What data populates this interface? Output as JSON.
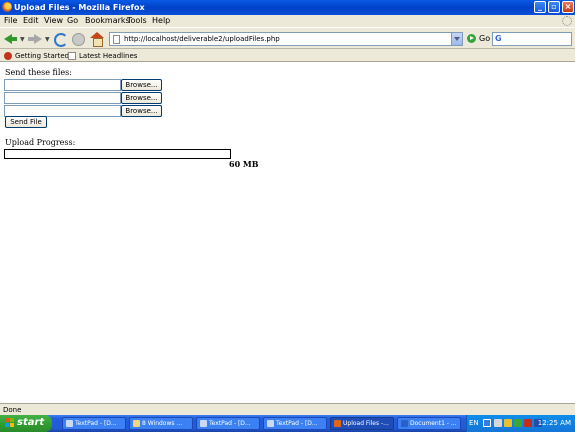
{
  "window": {
    "title": "Upload Files - Mozilla Firefox"
  },
  "menu": [
    "File",
    "Edit",
    "View",
    "Go",
    "Bookmarks",
    "Tools",
    "Help"
  ],
  "nav": {
    "url": "http://localhost/deliverable2/uploadFiles.php",
    "go_label": "Go",
    "search_value": ""
  },
  "bookmarks": [
    "Getting Started",
    "Latest Headlines"
  ],
  "page": {
    "send_label": "Send these files:",
    "browse_label": "Browse...",
    "send_button": "Send File",
    "progress_label": "Upload Progress:",
    "progress": 0,
    "size_text": "60 MB"
  },
  "status": {
    "text": "Done"
  },
  "taskbar": {
    "start": "start",
    "tasks": [
      {
        "label": "TextPad - [D...",
        "icon_color": "#c9d9f6",
        "active": false
      },
      {
        "label": "8 Windows ...",
        "icon_color": "#f2d57c",
        "active": false
      },
      {
        "label": "TextPad - [D...",
        "icon_color": "#c9d9f6",
        "active": false
      },
      {
        "label": "TextPad - [D...",
        "icon_color": "#c9d9f6",
        "active": false
      },
      {
        "label": "Upload Files -...",
        "icon_color": "#e2661a",
        "active": true
      },
      {
        "label": "Document1 - ...",
        "icon_color": "#2b5fc9",
        "active": false
      }
    ],
    "language": "EN",
    "clock": "12:25 AM"
  }
}
